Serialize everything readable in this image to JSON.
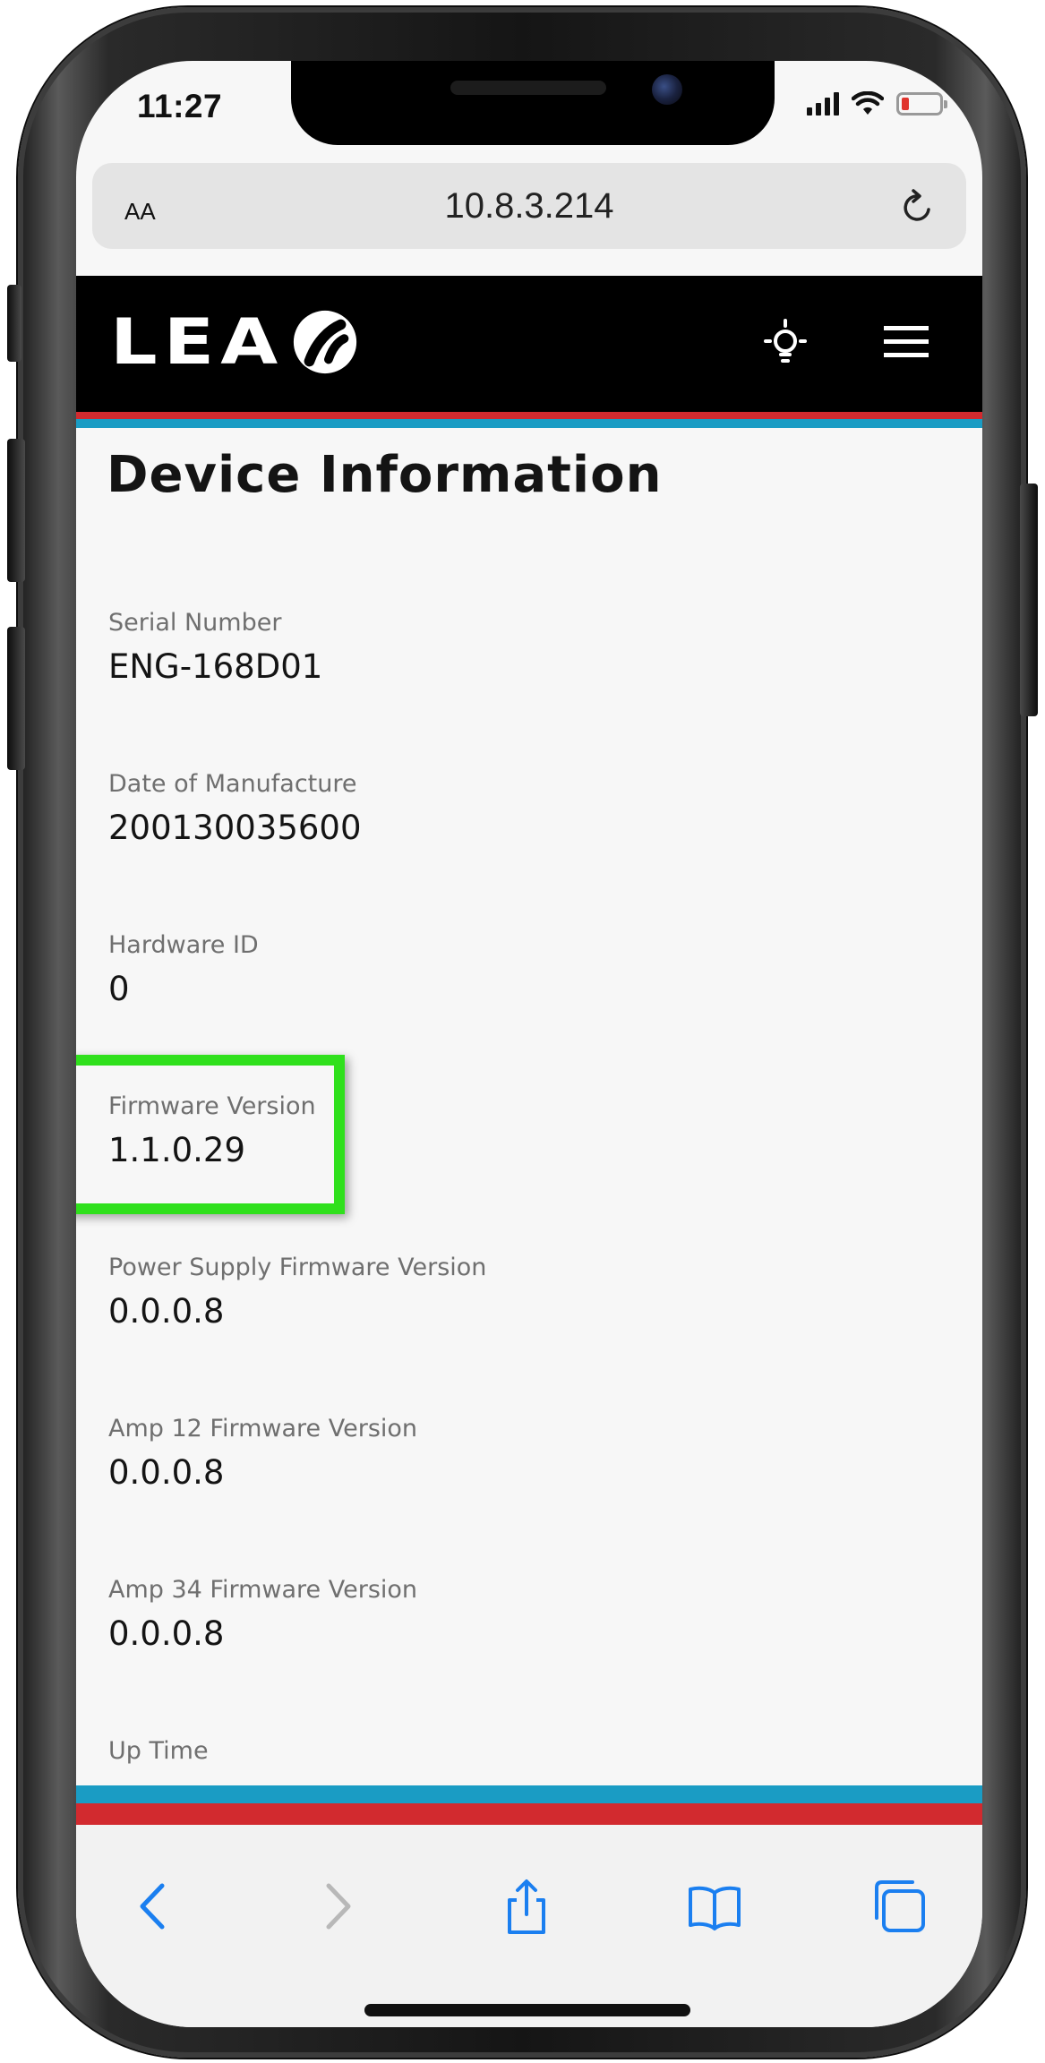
{
  "status_bar": {
    "time": "11:27"
  },
  "browser": {
    "text_size_button": "AA",
    "url": "10.8.3.214"
  },
  "site": {
    "logo_text": "LEA",
    "header_bg": "#000000",
    "stripe_colors": [
      "#d22a2f",
      "#1a9cc4"
    ],
    "highlight_color": "#2fe01c"
  },
  "page": {
    "title": "Device Information",
    "fields": [
      {
        "label": "Serial Number",
        "value": "ENG-168D01"
      },
      {
        "label": "Date of Manufacture",
        "value": "200130035600"
      },
      {
        "label": "Hardware ID",
        "value": "0"
      },
      {
        "label": "Firmware Version",
        "value": "1.1.0.29"
      },
      {
        "label": "Power Supply Firmware Version",
        "value": "0.0.0.8"
      },
      {
        "label": "Amp 12 Firmware Version",
        "value": "0.0.0.8"
      },
      {
        "label": "Amp 34 Firmware Version",
        "value": "0.0.0.8"
      },
      {
        "label": "Up Time",
        "value": ""
      }
    ]
  },
  "icons": {
    "status": [
      "cellular-signal-icon",
      "wifi-icon",
      "battery-icon"
    ],
    "header": [
      "bulb-icon",
      "menu-icon"
    ],
    "toolbar": [
      "back-icon",
      "forward-icon",
      "share-icon",
      "bookmarks-icon",
      "tabs-icon"
    ]
  }
}
